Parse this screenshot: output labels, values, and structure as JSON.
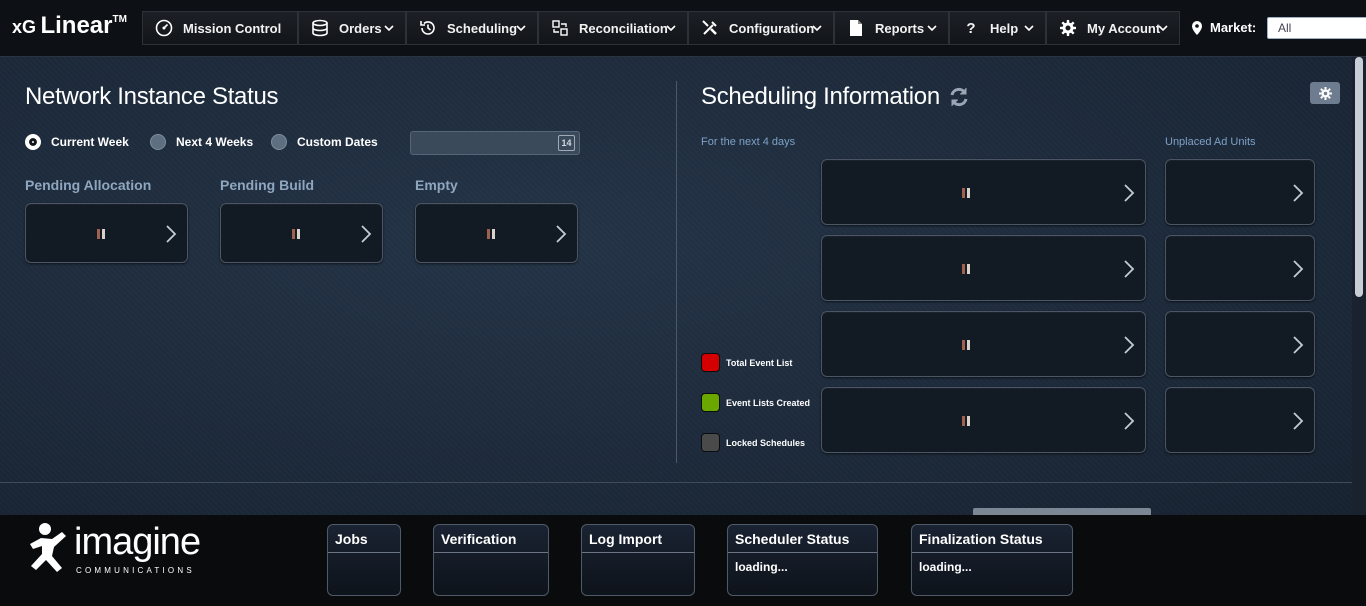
{
  "brand": {
    "xg": "xG",
    "name": "Linear",
    "tm": "TM"
  },
  "nav": [
    {
      "label": "Mission Control",
      "icon": "dashboard-icon"
    },
    {
      "label": "Orders",
      "icon": "database-icon"
    },
    {
      "label": "Scheduling",
      "icon": "clock-history-icon"
    },
    {
      "label": "Reconciliation",
      "icon": "reconcile-icon"
    },
    {
      "label": "Configuration",
      "icon": "tools-icon"
    },
    {
      "label": "Reports",
      "icon": "document-icon"
    },
    {
      "label": "Help",
      "icon": "question-icon"
    },
    {
      "label": "My Account",
      "icon": "gear-icon"
    }
  ],
  "market": {
    "label": "Market:",
    "value": "All"
  },
  "network": {
    "title": "Network Instance Status",
    "radios": [
      {
        "label": "Current Week",
        "selected": true
      },
      {
        "label": "Next 4 Weeks",
        "selected": false
      },
      {
        "label": "Custom Dates",
        "selected": false
      }
    ],
    "calendar_day": "14",
    "cards": [
      {
        "label": "Pending Allocation"
      },
      {
        "label": "Pending Build"
      },
      {
        "label": "Empty"
      }
    ]
  },
  "scheduling": {
    "title": "Scheduling Information",
    "subtitle": "For the next 4 days",
    "unplaced_label": "Unplaced Ad Units",
    "legend": [
      {
        "label": "Total Event List",
        "color": "#d40000"
      },
      {
        "label": "Event Lists Created",
        "color": "#6aa800"
      },
      {
        "label": "Locked Schedules",
        "color": "#4a4a4a"
      }
    ]
  },
  "footer": {
    "logo_word": "imagine",
    "logo_sub": "COMMUNICATIONS",
    "tiles": [
      {
        "title": "Jobs",
        "value": ""
      },
      {
        "title": "Verification",
        "value": ""
      },
      {
        "title": "Log Import",
        "value": ""
      },
      {
        "title": "Scheduler Status",
        "value": "loading..."
      },
      {
        "title": "Finalization Status",
        "value": "loading..."
      }
    ]
  },
  "colors": {
    "accent": "#8fa6bf",
    "background": "#1e2c3d",
    "topbar": "#0d1014"
  }
}
